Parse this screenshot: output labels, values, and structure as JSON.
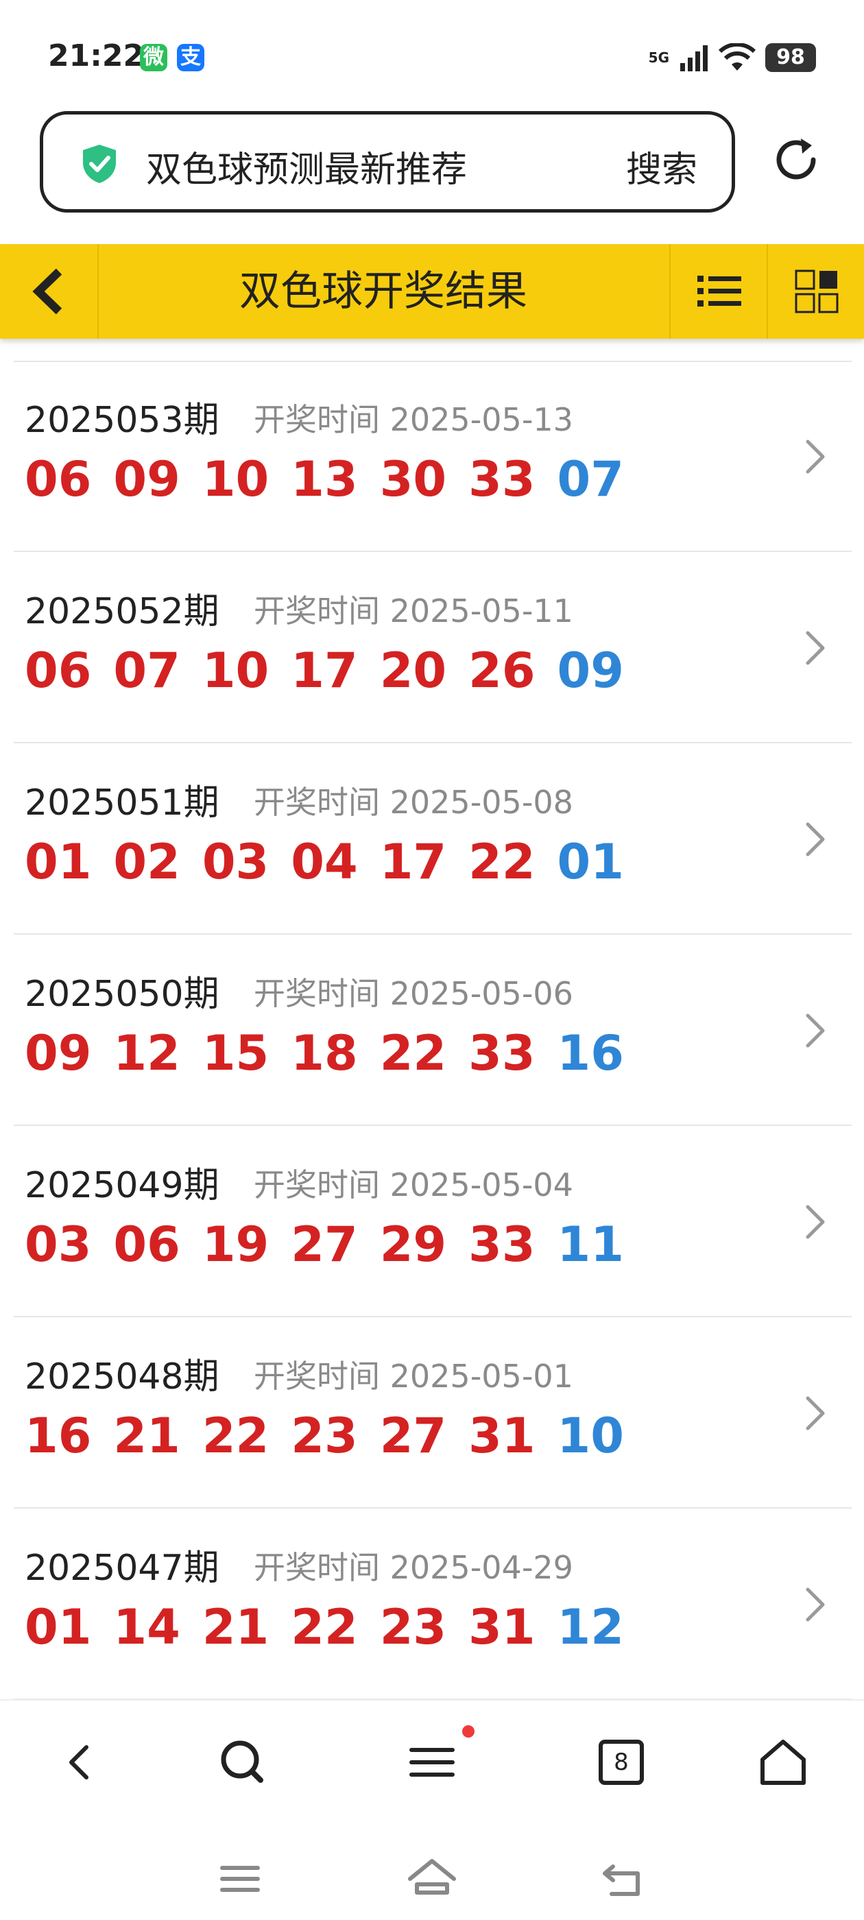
{
  "status_bar": {
    "time": "21:22",
    "battery": "98",
    "network": "5G",
    "badge_wechat": "微",
    "badge_alipay": "支"
  },
  "search": {
    "text": "双色球预测最新推荐",
    "button": "搜索"
  },
  "header": {
    "title": "双色球开奖结果"
  },
  "colors": {
    "header_bg": "#f7cc0c",
    "red_ball": "#d42222",
    "blue_ball": "#2f86d6"
  },
  "draws": [
    {
      "issue": "2025053期",
      "time_label": "开奖时间 2025-05-13",
      "red": [
        "06",
        "09",
        "10",
        "13",
        "30",
        "33"
      ],
      "blue": "07"
    },
    {
      "issue": "2025052期",
      "time_label": "开奖时间 2025-05-11",
      "red": [
        "06",
        "07",
        "10",
        "17",
        "20",
        "26"
      ],
      "blue": "09"
    },
    {
      "issue": "2025051期",
      "time_label": "开奖时间 2025-05-08",
      "red": [
        "01",
        "02",
        "03",
        "04",
        "17",
        "22"
      ],
      "blue": "01"
    },
    {
      "issue": "2025050期",
      "time_label": "开奖时间 2025-05-06",
      "red": [
        "09",
        "12",
        "15",
        "18",
        "22",
        "33"
      ],
      "blue": "16"
    },
    {
      "issue": "2025049期",
      "time_label": "开奖时间 2025-05-04",
      "red": [
        "03",
        "06",
        "19",
        "27",
        "29",
        "33"
      ],
      "blue": "11"
    },
    {
      "issue": "2025048期",
      "time_label": "开奖时间 2025-05-01",
      "red": [
        "16",
        "21",
        "22",
        "23",
        "27",
        "31"
      ],
      "blue": "10"
    },
    {
      "issue": "2025047期",
      "time_label": "开奖时间 2025-04-29",
      "red": [
        "01",
        "14",
        "21",
        "22",
        "23",
        "31"
      ],
      "blue": "12"
    }
  ],
  "bottom_nav": {
    "tab_count": "8"
  },
  "icons": [
    "shield-check-icon",
    "refresh-icon",
    "back-chevron-icon",
    "list-icon",
    "grid-icon",
    "chevron-right-icon",
    "back-icon",
    "search-icon",
    "menu-icon",
    "tabs-icon",
    "home-icon"
  ]
}
